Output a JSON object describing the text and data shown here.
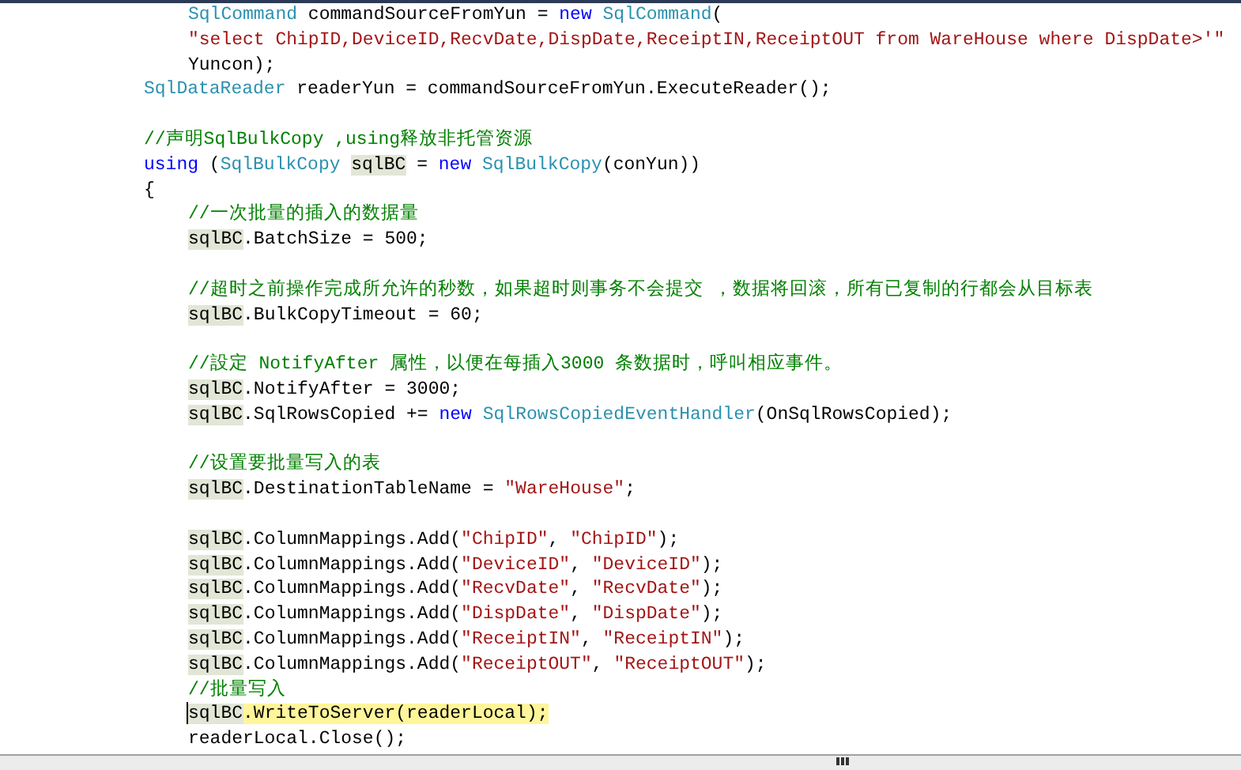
{
  "editor": {
    "lines": [
      {
        "kind": "nested",
        "caret": false,
        "tokens": [
          {
            "text": "SqlCommand",
            "kind": "type"
          },
          {
            "text": " commandSourceFromYun = ",
            "kind": "plain"
          },
          {
            "text": "new",
            "kind": "keyword"
          },
          {
            "text": " SqlCommand",
            "kind": "type"
          },
          {
            "text": "(",
            "kind": "plain"
          }
        ]
      },
      {
        "kind": "nested",
        "caret": false,
        "tokens": [
          {
            "text": "\"select ChipID,DeviceID,RecvDate,DispDate,ReceiptIN,ReceiptOUT from WareHouse where DispDate>'\"",
            "kind": "string"
          }
        ]
      },
      {
        "kind": "nested",
        "caret": false,
        "tokens": [
          {
            "text": "Yuncon);",
            "kind": "plain"
          }
        ]
      },
      {
        "kind": "code",
        "caret": false,
        "tokens": [
          {
            "text": "SqlDataReader",
            "kind": "type"
          },
          {
            "text": " readerYun = commandSourceFromYun.ExecuteReader();",
            "kind": "plain"
          }
        ]
      },
      {
        "kind": "blank"
      },
      {
        "kind": "code",
        "caret": false,
        "tokens": [
          {
            "text": "//声明SqlBulkCopy ,using释放非托管资源",
            "kind": "comment"
          }
        ]
      },
      {
        "kind": "code",
        "caret": false,
        "tokens": [
          {
            "text": "using",
            "kind": "keyword"
          },
          {
            "text": " (",
            "kind": "plain"
          },
          {
            "text": "SqlBulkCopy ",
            "kind": "type"
          },
          {
            "text": "sqlBC",
            "kind": "reference"
          },
          {
            "text": " = ",
            "kind": "plain"
          },
          {
            "text": "new",
            "kind": "keyword"
          },
          {
            "text": " SqlBulkCopy",
            "kind": "type"
          },
          {
            "text": "(conYun))",
            "kind": "plain"
          }
        ]
      },
      {
        "kind": "code",
        "caret": false,
        "tokens": [
          {
            "text": "{",
            "kind": "plain"
          }
        ]
      },
      {
        "kind": "nested",
        "caret": false,
        "tokens": [
          {
            "text": "//一次批量的插入的数据量",
            "kind": "comment"
          }
        ]
      },
      {
        "kind": "nested",
        "caret": false,
        "tokens": [
          {
            "text": "sqlBC",
            "kind": "reference"
          },
          {
            "text": ".BatchSize = 500;",
            "kind": "plain"
          }
        ]
      },
      {
        "kind": "blank"
      },
      {
        "kind": "nested",
        "caret": false,
        "tokens": [
          {
            "text": "//超时之前操作完成所允许的秒数，如果超时则事务不会提交 ，数据将回滚，所有已复制的行都会从目标表",
            "kind": "comment"
          }
        ]
      },
      {
        "kind": "nested",
        "caret": false,
        "tokens": [
          {
            "text": "sqlBC",
            "kind": "reference"
          },
          {
            "text": ".BulkCopyTimeout = 60;",
            "kind": "plain"
          }
        ]
      },
      {
        "kind": "blank"
      },
      {
        "kind": "nested",
        "caret": false,
        "tokens": [
          {
            "text": "//設定 NotifyAfter 属性，以便在每插入3000 条数据时，呼叫相应事件。",
            "kind": "comment"
          }
        ]
      },
      {
        "kind": "nested",
        "caret": false,
        "tokens": [
          {
            "text": "sqlBC",
            "kind": "reference"
          },
          {
            "text": ".NotifyAfter = 3000;",
            "kind": "plain"
          }
        ]
      },
      {
        "kind": "nested",
        "caret": false,
        "tokens": [
          {
            "text": "sqlBC",
            "kind": "reference"
          },
          {
            "text": ".SqlRowsCopied += ",
            "kind": "plain"
          },
          {
            "text": "new",
            "kind": "keyword"
          },
          {
            "text": " SqlRowsCopiedEventHandler",
            "kind": "type"
          },
          {
            "text": "(OnSqlRowsCopied);",
            "kind": "plain"
          }
        ]
      },
      {
        "kind": "blank"
      },
      {
        "kind": "nested",
        "caret": false,
        "tokens": [
          {
            "text": "//设置要批量写入的表",
            "kind": "comment"
          }
        ]
      },
      {
        "kind": "nested",
        "caret": false,
        "tokens": [
          {
            "text": "sqlBC",
            "kind": "reference"
          },
          {
            "text": ".DestinationTableName = ",
            "kind": "plain"
          },
          {
            "text": "\"WareHouse\"",
            "kind": "string"
          },
          {
            "text": ";",
            "kind": "plain"
          }
        ]
      },
      {
        "kind": "blank"
      },
      {
        "kind": "nested",
        "caret": false,
        "tokens": [
          {
            "text": "sqlBC",
            "kind": "reference"
          },
          {
            "text": ".ColumnMappings.Add(",
            "kind": "plain"
          },
          {
            "text": "\"ChipID\"",
            "kind": "string"
          },
          {
            "text": ", ",
            "kind": "plain"
          },
          {
            "text": "\"ChipID\"",
            "kind": "string"
          },
          {
            "text": ");",
            "kind": "plain"
          }
        ]
      },
      {
        "kind": "nested",
        "caret": false,
        "tokens": [
          {
            "text": "sqlBC",
            "kind": "reference"
          },
          {
            "text": ".ColumnMappings.Add(",
            "kind": "plain"
          },
          {
            "text": "\"DeviceID\"",
            "kind": "string"
          },
          {
            "text": ", ",
            "kind": "plain"
          },
          {
            "text": "\"DeviceID\"",
            "kind": "string"
          },
          {
            "text": ");",
            "kind": "plain"
          }
        ]
      },
      {
        "kind": "nested",
        "caret": false,
        "tokens": [
          {
            "text": "sqlBC",
            "kind": "reference"
          },
          {
            "text": ".ColumnMappings.Add(",
            "kind": "plain"
          },
          {
            "text": "\"RecvDate\"",
            "kind": "string"
          },
          {
            "text": ", ",
            "kind": "plain"
          },
          {
            "text": "\"RecvDate\"",
            "kind": "string"
          },
          {
            "text": ");",
            "kind": "plain"
          }
        ]
      },
      {
        "kind": "nested",
        "caret": false,
        "tokens": [
          {
            "text": "sqlBC",
            "kind": "reference"
          },
          {
            "text": ".ColumnMappings.Add(",
            "kind": "plain"
          },
          {
            "text": "\"DispDate\"",
            "kind": "string"
          },
          {
            "text": ", ",
            "kind": "plain"
          },
          {
            "text": "\"DispDate\"",
            "kind": "string"
          },
          {
            "text": ");",
            "kind": "plain"
          }
        ]
      },
      {
        "kind": "nested",
        "caret": false,
        "tokens": [
          {
            "text": "sqlBC",
            "kind": "reference"
          },
          {
            "text": ".ColumnMappings.Add(",
            "kind": "plain"
          },
          {
            "text": "\"ReceiptIN\"",
            "kind": "string"
          },
          {
            "text": ", ",
            "kind": "plain"
          },
          {
            "text": "\"ReceiptIN\"",
            "kind": "string"
          },
          {
            "text": ");",
            "kind": "plain"
          }
        ]
      },
      {
        "kind": "nested",
        "caret": false,
        "tokens": [
          {
            "text": "sqlBC",
            "kind": "reference"
          },
          {
            "text": ".ColumnMappings.Add(",
            "kind": "plain"
          },
          {
            "text": "\"ReceiptOUT\"",
            "kind": "string"
          },
          {
            "text": ", ",
            "kind": "plain"
          },
          {
            "text": "\"ReceiptOUT\"",
            "kind": "string"
          },
          {
            "text": ");",
            "kind": "plain"
          }
        ]
      },
      {
        "kind": "nested",
        "caret": false,
        "tokens": [
          {
            "text": "//批量写入",
            "kind": "comment"
          }
        ]
      },
      {
        "kind": "nested",
        "caret": true,
        "tokens": [
          {
            "text": "sqlBC",
            "kind": "reference"
          },
          {
            "text": ".WriteToServer(readerLocal);",
            "kind": "current"
          }
        ]
      },
      {
        "kind": "nested",
        "caret": false,
        "tokens": [
          {
            "text": "readerLocal.Close();",
            "kind": "plain"
          }
        ]
      }
    ]
  }
}
